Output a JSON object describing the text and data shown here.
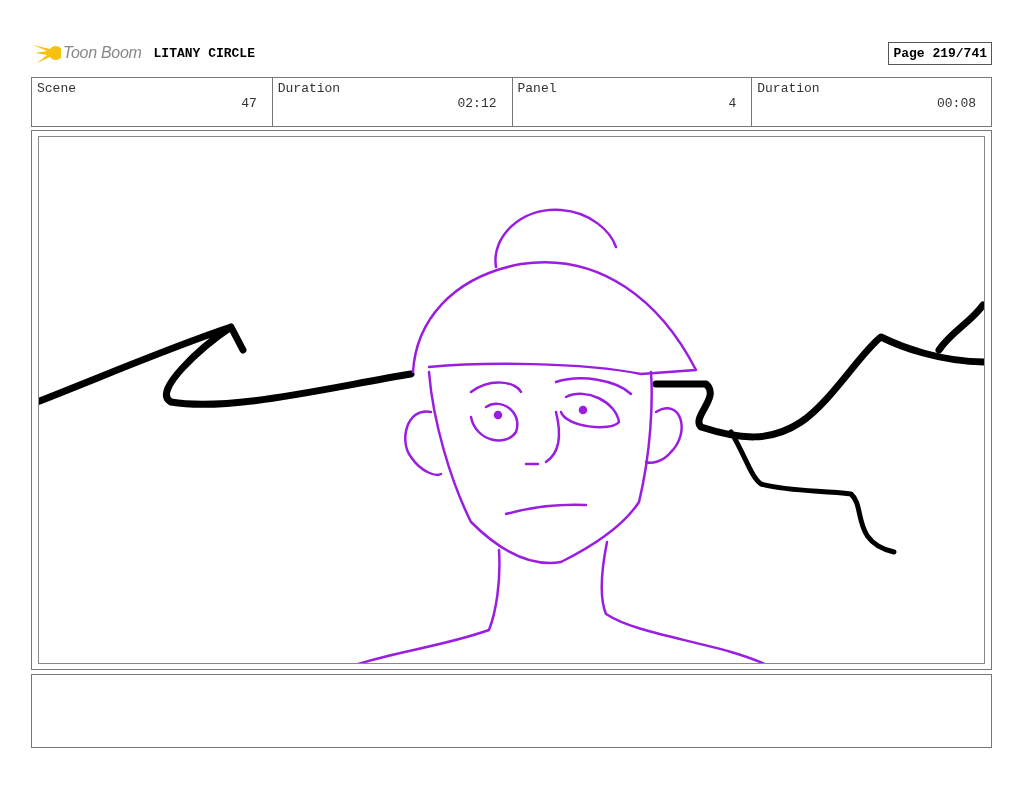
{
  "header": {
    "logo": "Toon Boom",
    "project": "LITANY CIRCLE",
    "page": "Page 219/741"
  },
  "fields": [
    {
      "label": "Scene",
      "value": "47"
    },
    {
      "label": "Duration",
      "value": "02:12"
    },
    {
      "label": "Panel",
      "value": "4"
    },
    {
      "label": "Duration",
      "value": "00:08"
    }
  ]
}
